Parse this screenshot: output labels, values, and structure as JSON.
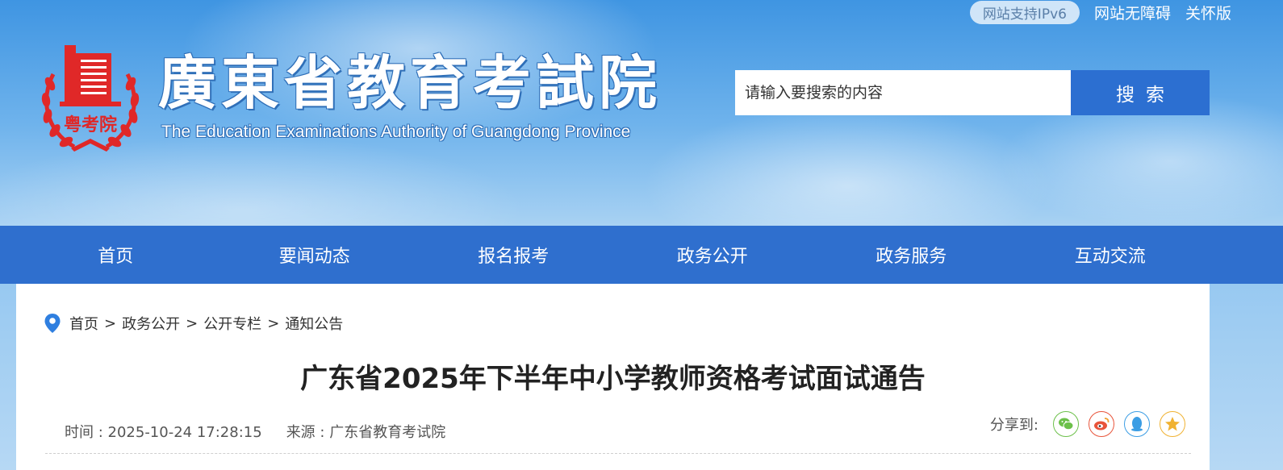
{
  "header": {
    "ipv6_badge": "网站支持IPv6",
    "links": [
      "网站无障碍",
      "关怀版"
    ],
    "logo_cn": "廣東省教育考試院",
    "logo_en": "The Education Examinations Authority of Guangdong Province",
    "emblem_text": "粤考院"
  },
  "search": {
    "placeholder": "请输入要搜索的内容",
    "button_label": "搜索"
  },
  "nav": [
    "首页",
    "要闻动态",
    "报名报考",
    "政务公开",
    "政务服务",
    "互动交流"
  ],
  "breadcrumb": [
    "首页",
    "政务公开",
    "公开专栏",
    "通知公告"
  ],
  "breadcrumb_sep": ">",
  "article": {
    "title": "广东省2025年下半年中小学教师资格考试面试通告",
    "time_label": "时间 : 2025-10-24 17:28:15",
    "source_label": "来源 : 广东省教育考试院"
  },
  "share": {
    "label": "分享到:",
    "icons": [
      "wechat-icon",
      "weibo-icon",
      "qq-icon",
      "qzone-icon"
    ],
    "colors": {
      "wechat": "#6cc04a",
      "weibo": "#e8543a",
      "qq": "#3b9de4",
      "qzone": "#f0b232"
    }
  },
  "colors": {
    "nav_bg": "#2f6fce",
    "search_button": "#2c6fd1",
    "emblem_red": "#e02828"
  }
}
